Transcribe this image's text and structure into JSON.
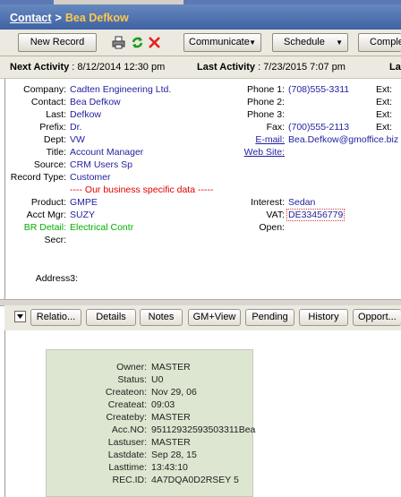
{
  "breadcrumb": {
    "section": "Contact",
    "record": "Bea Defkow"
  },
  "toolbar": {
    "new_record": "New Record",
    "communicate": "Communicate",
    "schedule": "Schedule",
    "complete": "Complet"
  },
  "activity": {
    "next_label": "Next Activity",
    "next_value": ": 8/12/2014 12:30 pm",
    "last_label": "Last Activity",
    "last_value": ": 7/23/2015 7:07 pm",
    "last3": "La"
  },
  "left_fields": [
    {
      "label": "Company:",
      "value": "Cadten Engineering Ltd."
    },
    {
      "label": "Contact:",
      "value": "Bea Defkow"
    },
    {
      "label": "Last:",
      "value": "Defkow"
    },
    {
      "label": "Prefix:",
      "value": "Dr."
    },
    {
      "label": "Dept:",
      "value": "VW"
    },
    {
      "label": "Title:",
      "value": "Account Manager"
    },
    {
      "label": "Source:",
      "value": "CRM Users Sp"
    },
    {
      "label": "Record Type:",
      "value": "Customer"
    }
  ],
  "separator_text": "---- Our business specific data -----",
  "right_fields": [
    {
      "label": "Phone 1:",
      "value": "(708)555-3311",
      "ext": "Ext:"
    },
    {
      "label": "Phone 2:",
      "value": "",
      "ext": "Ext:"
    },
    {
      "label": "Phone 3:",
      "value": "",
      "ext": "Ext:"
    },
    {
      "label": "Fax:",
      "value": "(700)555-2113",
      "ext": "Ext:"
    },
    {
      "label": "E-mail:",
      "value": "Bea.Defkow@gmoffice.biz"
    },
    {
      "label": "Web Site:",
      "value": ""
    }
  ],
  "business_left": [
    {
      "label": "Product:",
      "value": "GMPE"
    },
    {
      "label": "Acct Mgr:",
      "value": "SUZY"
    },
    {
      "label": "BR Detail:",
      "value": "Electrical Contr"
    },
    {
      "label": "Secr:",
      "value": ""
    }
  ],
  "business_right": [
    {
      "label": "Interest:",
      "value": "Sedan"
    },
    {
      "label": "VAT:",
      "value": "DE33456779"
    },
    {
      "label": "Open:",
      "value": ""
    }
  ],
  "address3_label": "Address3:",
  "tabs": [
    "Relatio...",
    "Details",
    "Notes",
    "GM+View",
    "Pending",
    "History",
    "Opport..."
  ],
  "info_card": [
    {
      "label": "Owner:",
      "value": "MASTER"
    },
    {
      "label": "Status:",
      "value": "U0"
    },
    {
      "label": "Createon:",
      "value": "Nov 29, 06"
    },
    {
      "label": "Createat:",
      "value": "09:03"
    },
    {
      "label": "Createby:",
      "value": "MASTER"
    },
    {
      "label": "Acc.NO:",
      "value": "95112932593503311Bea"
    },
    {
      "label": "Lastuser:",
      "value": "MASTER"
    },
    {
      "label": "Lastdate:",
      "value": "Sep 28, 15"
    },
    {
      "label": "Lasttime:",
      "value": "13:43:10"
    },
    {
      "label": "REC.ID:",
      "value": "4A7DQA0D2RSEY 5"
    }
  ],
  "icons": {
    "print": "printer-icon",
    "refresh": "refresh-icon",
    "delete": "delete-icon",
    "dropdown": "dropdown-arrow-icon",
    "collapse": "collapse-icon"
  },
  "colors": {
    "header": "#3f62a2",
    "breadcrumb_record": "#ffc84a",
    "value_text": "#1f1f9f",
    "green": "#00b000",
    "red": "#e00000",
    "card_bg": "#dde6d0"
  }
}
